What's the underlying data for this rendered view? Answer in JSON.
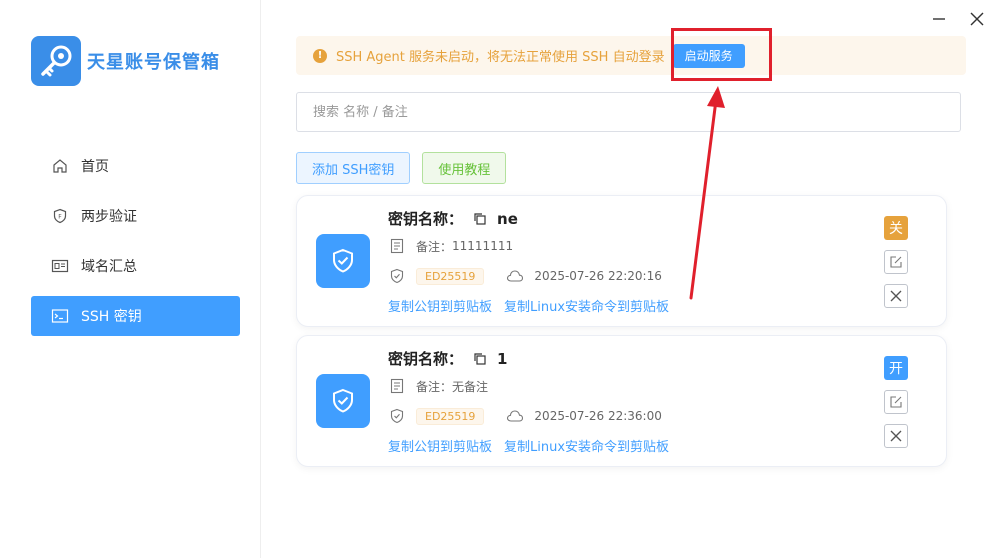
{
  "app": {
    "title": "天星账号保管箱",
    "brand_color": "#3a8ee8",
    "logo_icon": "key-icon"
  },
  "window": {
    "minimize_icon": "minimize-icon",
    "close_icon": "close-icon"
  },
  "sidebar": {
    "items": [
      {
        "label": "首页",
        "icon": "home-icon",
        "active": false
      },
      {
        "label": "两步验证",
        "icon": "shield-icon",
        "active": false
      },
      {
        "label": "域名汇总",
        "icon": "id-card-icon",
        "active": false
      },
      {
        "label": "SSH 密钥",
        "icon": "terminal-icon",
        "active": true
      }
    ]
  },
  "alert": {
    "message": "SSH Agent 服务未启动，将无法正常使用 SSH 自动登录",
    "button_label": "启动服务",
    "color": "#e6a23c"
  },
  "search": {
    "placeholder": "搜索 名称 / 备注",
    "value": ""
  },
  "toolbar": {
    "add_label": "添加 SSH密钥",
    "tutorial_label": "使用教程"
  },
  "labels": {
    "name_prefix": "密钥名称：",
    "note_prefix": "备注："
  },
  "keys": [
    {
      "name": "ne",
      "note": "11111111",
      "type": "ED25519",
      "created": "2025-07-26 22:20:16",
      "copy_pub": "复制公钥到剪贴板",
      "copy_linux": "复制Linux安装命令到剪贴板",
      "state": "关",
      "state_color": "#e6a23c"
    },
    {
      "name": "1",
      "note": "无备注",
      "type": "ED25519",
      "created": "2025-07-26 22:36:00",
      "copy_pub": "复制公钥到剪贴板",
      "copy_linux": "复制Linux安装命令到剪贴板",
      "state": "开",
      "state_color": "#409eff"
    }
  ]
}
